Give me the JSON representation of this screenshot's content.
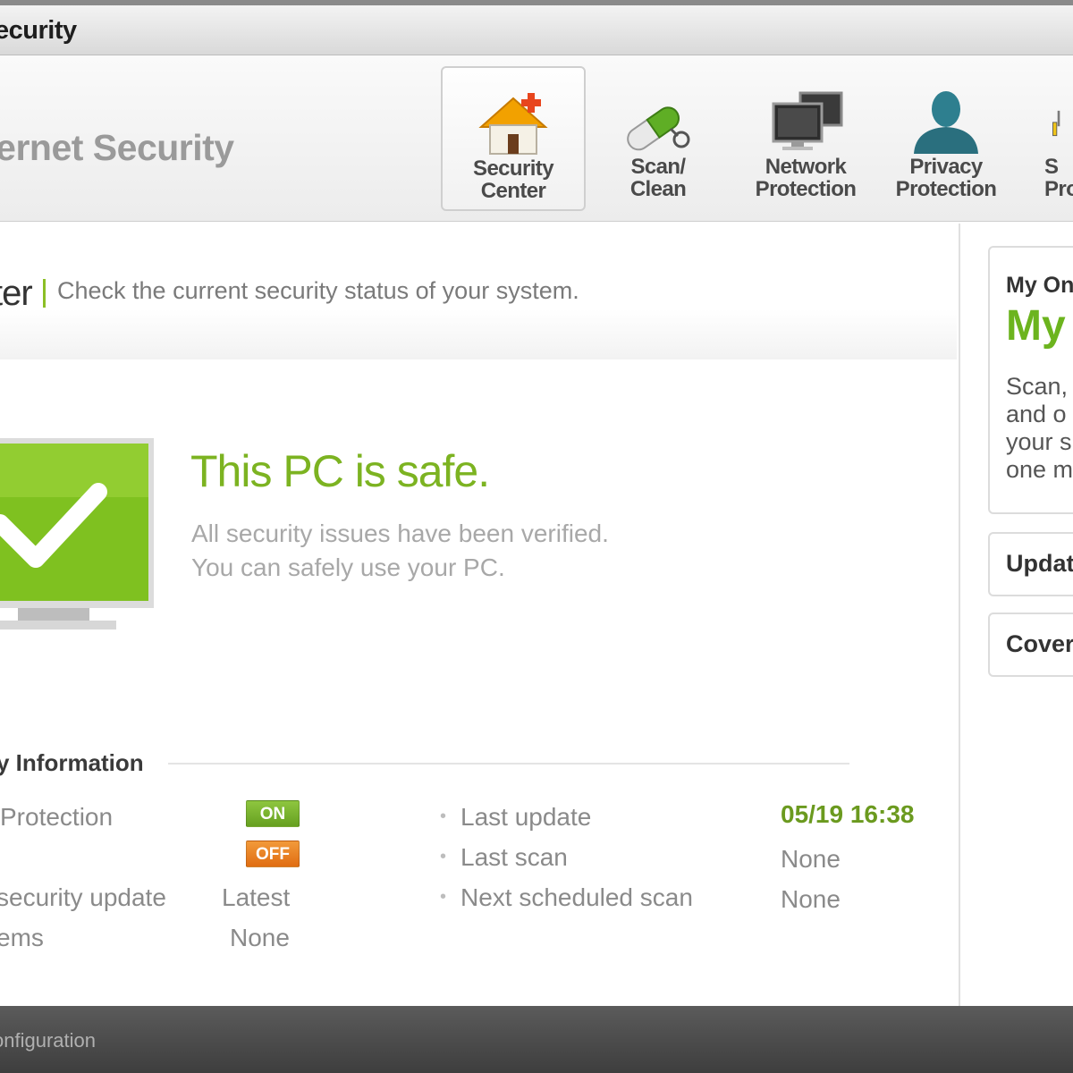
{
  "window": {
    "title": "ecurity"
  },
  "header": {
    "product_name": "ternet Security",
    "nav": [
      {
        "label_line1": "Security",
        "label_line2": "Center",
        "icon": "house-icon",
        "active": true
      },
      {
        "label_line1": "Scan/",
        "label_line2": "Clean",
        "icon": "pill-scan-icon",
        "active": false
      },
      {
        "label_line1": "Network",
        "label_line2": "Protection",
        "icon": "network-monitors-icon",
        "active": false
      },
      {
        "label_line1": "Privacy",
        "label_line2": "Protection",
        "icon": "user-silhouette-icon",
        "active": false
      },
      {
        "label_line1": "S",
        "label_line2": "Pro",
        "icon": "tools-icon",
        "active": false
      }
    ]
  },
  "section": {
    "title": "ter",
    "description": "Check the current security status of your system."
  },
  "status": {
    "title": "This PC is safe.",
    "line1": "All security issues have been verified.",
    "line2": "You can safely use your PC."
  },
  "info": {
    "title": "y Information",
    "left_rows": [
      {
        "label": "Protection",
        "badge": "ON"
      },
      {
        "label": "",
        "badge": "OFF"
      },
      {
        "label": "security update",
        "value": "Latest"
      },
      {
        "label": "ems",
        "value": "None"
      }
    ],
    "right_rows": [
      {
        "label": "Last update",
        "value": "05/19 16:38"
      },
      {
        "label": "Last scan",
        "value": "None"
      },
      {
        "label": "Next scheduled scan",
        "value": "None"
      }
    ]
  },
  "right_panel": {
    "card_small": "My On",
    "card_big": "My (",
    "card_text": "Scan,\nand o\nyour s\none m",
    "update_button": "Updat",
    "cover_button": "Cover"
  },
  "footer": {
    "link": "onfiguration"
  },
  "colors": {
    "accent_green": "#7cb321",
    "badge_on": "#77b12e",
    "badge_off": "#e8791d"
  }
}
